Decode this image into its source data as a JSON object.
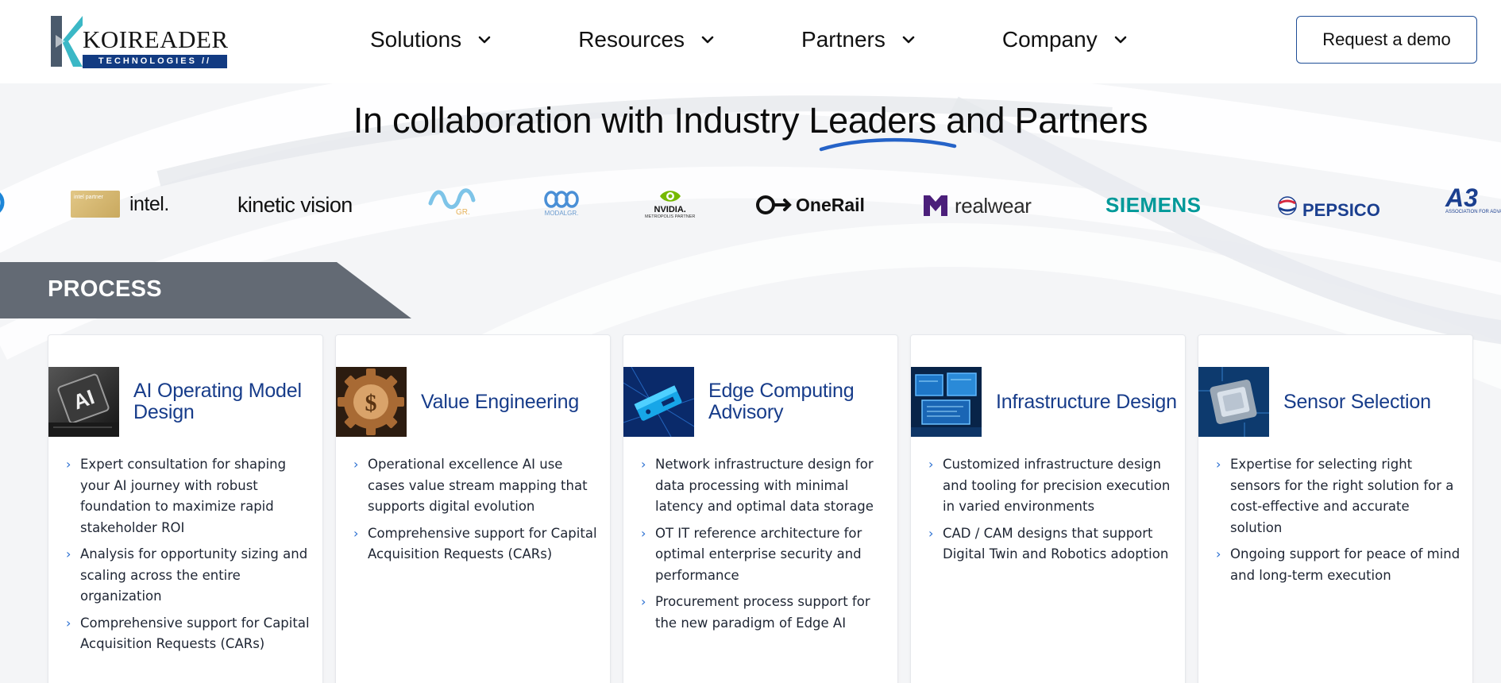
{
  "header": {
    "logo": {
      "word": "KOIREADER",
      "sub": "TECHNOLOGIES //"
    },
    "nav": [
      {
        "label": "Solutions"
      },
      {
        "label": "Resources"
      },
      {
        "label": "Partners"
      },
      {
        "label": "Company"
      }
    ],
    "cta_label": "Request a demo"
  },
  "headline": {
    "pre": "In collaboration with Industry ",
    "highlight": "Leaders",
    "post": " and Partners"
  },
  "partners": [
    {
      "name": "intel partner",
      "text": "intel.",
      "badge": "intel partner"
    },
    {
      "name": "kinetic vision",
      "text": "kinetic vision"
    },
    {
      "name": "modal-gr-1",
      "text": "GR."
    },
    {
      "name": "modal-gr-2",
      "text": "MODALGR."
    },
    {
      "name": "nvidia",
      "text": "NVIDIA.",
      "sub": "METROPOLIS PARTNER"
    },
    {
      "name": "onerail",
      "text": "OneRail"
    },
    {
      "name": "realwear",
      "text": "realwear"
    },
    {
      "name": "siemens",
      "text": "SIEMENS"
    },
    {
      "name": "pepsico",
      "text": "PEPSICO"
    },
    {
      "name": "a3",
      "text": "A3",
      "sub": "ASSOCIATION FOR ADVANCING AUTOMATION"
    }
  ],
  "colors": {
    "brand_blue": "#173c8a",
    "band_gray": "#636a74",
    "accent_blue": "#2a6fd1",
    "siemens_teal": "#009999",
    "realwear_purple": "#4b1f7a",
    "pepsico_blue": "#1b3f8f"
  },
  "process": {
    "label": "PROCESS",
    "cards": [
      {
        "title": "AI Operating Model Design",
        "icon": "ai-chip-icon",
        "items": [
          "Expert consultation for shaping your AI journey with robust foundation to maximize rapid stakeholder ROI",
          "Analysis for opportunity sizing and scaling across the entire organization",
          "Comprehensive support for Capital Acquisition Requests (CARs)"
        ]
      },
      {
        "title": "Value Engineering",
        "icon": "dollar-gear-icon",
        "items": [
          "Operational excellence AI use cases value stream mapping that supports digital evolution",
          "Comprehensive support for Capital Acquisition Requests (CARs)"
        ]
      },
      {
        "title": "Edge Computing Advisory",
        "icon": "edge-device-icon",
        "items": [
          "Network infrastructure design for data processing with minimal latency and optimal data storage",
          "OT IT reference architecture for optimal enterprise security and performance",
          "Procurement process support for the new paradigm of Edge AI"
        ]
      },
      {
        "title": "Infrastructure Design",
        "icon": "monitors-icon",
        "items": [
          "Customized infrastructure design and tooling for precision execution in varied environments",
          "CAD / CAM designs that support Digital Twin and Robotics adoption"
        ]
      },
      {
        "title": "Sensor Selection",
        "icon": "sensor-chip-icon",
        "items": [
          "Expertise for selecting right sensors for the right solution for a cost-effective and accurate solution",
          "Ongoing support for peace of mind and long-term execution"
        ]
      }
    ]
  }
}
